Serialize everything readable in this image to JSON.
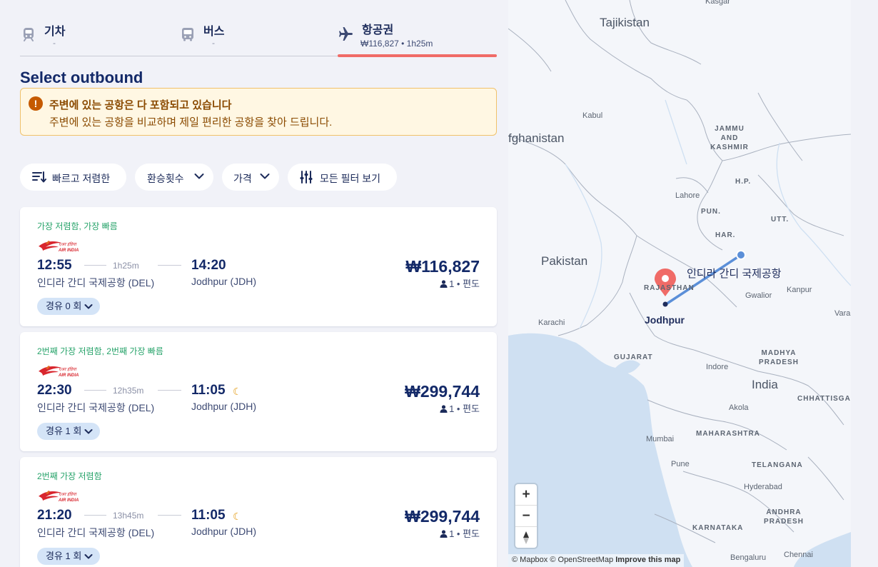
{
  "tabs": {
    "train": {
      "label": "기차",
      "sub": "-"
    },
    "bus": {
      "label": "버스",
      "sub": "-"
    },
    "flight": {
      "label": "항공권",
      "sub": "₩116,827 • 1h25m",
      "active": true
    }
  },
  "page_title": "Select outbound",
  "notice": {
    "title": "주변에 있는 공항은 다 포함되고 있습니다",
    "text": "주변에 있는 공항을 비교하며 제일 편리한 공항을 찾아 드립니다."
  },
  "filters": {
    "fast_cheap": "빠르고 저렴한",
    "stops": "환승횟수",
    "price": "가격",
    "all": "모든 필터 보기"
  },
  "results": [
    {
      "badge": "가장 저렴함, 가장 빠름",
      "airline_icon": "air-india-logo",
      "dep_time": "12:55",
      "duration": "1h25m",
      "arr_time": "14:20",
      "overnight": false,
      "dep_airport": "인디라 간디 국제공항 (DEL)",
      "arr_airport": "Jodhpur (JDH)",
      "price": "₩116,827",
      "pax": "1 • 편도",
      "stops": "경유 0 회"
    },
    {
      "badge": "2번째 가장 저렴함, 2번째 가장 빠름",
      "airline_icon": "air-india-logo",
      "dep_time": "22:30",
      "duration": "12h35m",
      "arr_time": "11:05",
      "overnight": true,
      "dep_airport": "인디라 간디 국제공항 (DEL)",
      "arr_airport": "Jodhpur (JDH)",
      "price": "₩299,744",
      "pax": "1 • 편도",
      "stops": "경유 1 회"
    },
    {
      "badge": "2번째 가장 저렴함",
      "airline_icon": "air-india-logo",
      "dep_time": "21:20",
      "duration": "13h45m",
      "arr_time": "11:05",
      "overnight": true,
      "dep_airport": "인디라 간디 국제공항 (DEL)",
      "arr_airport": "Jodhpur (JDH)",
      "price": "₩299,744",
      "pax": "1 • 편도",
      "stops": "경유 1 회"
    }
  ],
  "map": {
    "origin_label": "인디라 간디 국제공항",
    "destination_label": "Jodhpur",
    "countries": {
      "tajikistan": "Tajikistan",
      "afghanistan": "fghanistan",
      "pakistan": "Pakistan",
      "india": "India"
    },
    "regions": {
      "jammu_kashmir": "JAMMU\nAND\nKASHMIR",
      "hp": "H.P.",
      "pun": "PUN.",
      "utt": "UTT.",
      "har": "HAR.",
      "rajasthan": "RAJASTHAN",
      "gujarat": "GUJARAT",
      "madhya_pradesh": "MADHYA\nPRADESH",
      "chhattisgarh": "CHHATTISGA",
      "maharashtra": "MAHARASHTRA",
      "telangana": "TELANGANA",
      "andhra_pradesh": "ANDHRA\nPRADESH",
      "karnataka": "KARNATAKA"
    },
    "cities": {
      "kasgar": "Kasgar",
      "kabul": "Kabul",
      "lahore": "Lahore",
      "karachi": "Karachi",
      "gwalior": "Gwalior",
      "kanpur": "Kanpur",
      "vara": "Vara",
      "indore": "Indore",
      "akola": "Akola",
      "mumbai": "Mumbai",
      "pune": "Pune",
      "hyderabad": "Hyderabad",
      "bengaluru": "Bengaluru",
      "chennai": "Chennai"
    },
    "zoom_in": "+",
    "zoom_out": "−",
    "attribution": "© Mapbox © OpenStreetMap",
    "improve": "Improve this map",
    "route_color": "#5b8fd8",
    "pin_color": "#f06b67",
    "water_color": "#cfe0f2"
  }
}
